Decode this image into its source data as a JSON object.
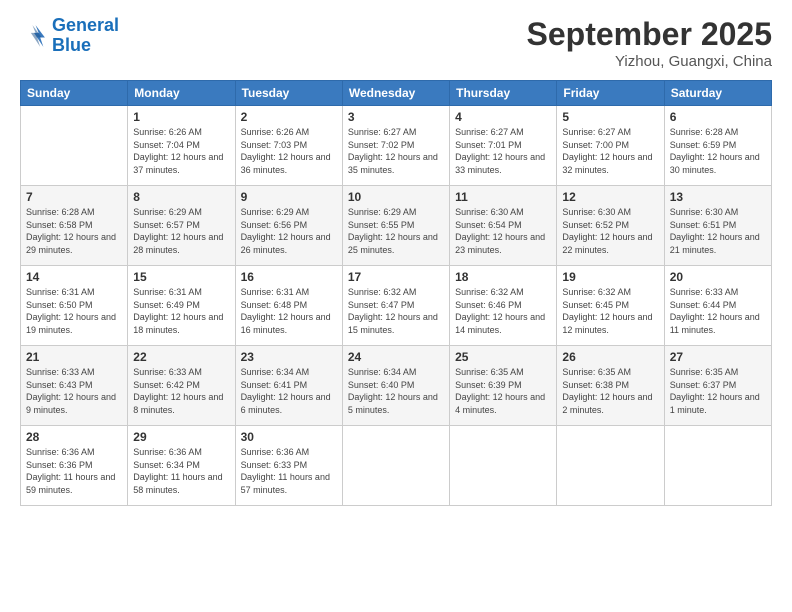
{
  "logo": {
    "line1": "General",
    "line2": "Blue"
  },
  "title": "September 2025",
  "subtitle": "Yizhou, Guangxi, China",
  "weekdays": [
    "Sunday",
    "Monday",
    "Tuesday",
    "Wednesday",
    "Thursday",
    "Friday",
    "Saturday"
  ],
  "weeks": [
    [
      {
        "day": "",
        "sunrise": "",
        "sunset": "",
        "daylight": ""
      },
      {
        "day": "1",
        "sunrise": "Sunrise: 6:26 AM",
        "sunset": "Sunset: 7:04 PM",
        "daylight": "Daylight: 12 hours and 37 minutes."
      },
      {
        "day": "2",
        "sunrise": "Sunrise: 6:26 AM",
        "sunset": "Sunset: 7:03 PM",
        "daylight": "Daylight: 12 hours and 36 minutes."
      },
      {
        "day": "3",
        "sunrise": "Sunrise: 6:27 AM",
        "sunset": "Sunset: 7:02 PM",
        "daylight": "Daylight: 12 hours and 35 minutes."
      },
      {
        "day": "4",
        "sunrise": "Sunrise: 6:27 AM",
        "sunset": "Sunset: 7:01 PM",
        "daylight": "Daylight: 12 hours and 33 minutes."
      },
      {
        "day": "5",
        "sunrise": "Sunrise: 6:27 AM",
        "sunset": "Sunset: 7:00 PM",
        "daylight": "Daylight: 12 hours and 32 minutes."
      },
      {
        "day": "6",
        "sunrise": "Sunrise: 6:28 AM",
        "sunset": "Sunset: 6:59 PM",
        "daylight": "Daylight: 12 hours and 30 minutes."
      }
    ],
    [
      {
        "day": "7",
        "sunrise": "Sunrise: 6:28 AM",
        "sunset": "Sunset: 6:58 PM",
        "daylight": "Daylight: 12 hours and 29 minutes."
      },
      {
        "day": "8",
        "sunrise": "Sunrise: 6:29 AM",
        "sunset": "Sunset: 6:57 PM",
        "daylight": "Daylight: 12 hours and 28 minutes."
      },
      {
        "day": "9",
        "sunrise": "Sunrise: 6:29 AM",
        "sunset": "Sunset: 6:56 PM",
        "daylight": "Daylight: 12 hours and 26 minutes."
      },
      {
        "day": "10",
        "sunrise": "Sunrise: 6:29 AM",
        "sunset": "Sunset: 6:55 PM",
        "daylight": "Daylight: 12 hours and 25 minutes."
      },
      {
        "day": "11",
        "sunrise": "Sunrise: 6:30 AM",
        "sunset": "Sunset: 6:54 PM",
        "daylight": "Daylight: 12 hours and 23 minutes."
      },
      {
        "day": "12",
        "sunrise": "Sunrise: 6:30 AM",
        "sunset": "Sunset: 6:52 PM",
        "daylight": "Daylight: 12 hours and 22 minutes."
      },
      {
        "day": "13",
        "sunrise": "Sunrise: 6:30 AM",
        "sunset": "Sunset: 6:51 PM",
        "daylight": "Daylight: 12 hours and 21 minutes."
      }
    ],
    [
      {
        "day": "14",
        "sunrise": "Sunrise: 6:31 AM",
        "sunset": "Sunset: 6:50 PM",
        "daylight": "Daylight: 12 hours and 19 minutes."
      },
      {
        "day": "15",
        "sunrise": "Sunrise: 6:31 AM",
        "sunset": "Sunset: 6:49 PM",
        "daylight": "Daylight: 12 hours and 18 minutes."
      },
      {
        "day": "16",
        "sunrise": "Sunrise: 6:31 AM",
        "sunset": "Sunset: 6:48 PM",
        "daylight": "Daylight: 12 hours and 16 minutes."
      },
      {
        "day": "17",
        "sunrise": "Sunrise: 6:32 AM",
        "sunset": "Sunset: 6:47 PM",
        "daylight": "Daylight: 12 hours and 15 minutes."
      },
      {
        "day": "18",
        "sunrise": "Sunrise: 6:32 AM",
        "sunset": "Sunset: 6:46 PM",
        "daylight": "Daylight: 12 hours and 14 minutes."
      },
      {
        "day": "19",
        "sunrise": "Sunrise: 6:32 AM",
        "sunset": "Sunset: 6:45 PM",
        "daylight": "Daylight: 12 hours and 12 minutes."
      },
      {
        "day": "20",
        "sunrise": "Sunrise: 6:33 AM",
        "sunset": "Sunset: 6:44 PM",
        "daylight": "Daylight: 12 hours and 11 minutes."
      }
    ],
    [
      {
        "day": "21",
        "sunrise": "Sunrise: 6:33 AM",
        "sunset": "Sunset: 6:43 PM",
        "daylight": "Daylight: 12 hours and 9 minutes."
      },
      {
        "day": "22",
        "sunrise": "Sunrise: 6:33 AM",
        "sunset": "Sunset: 6:42 PM",
        "daylight": "Daylight: 12 hours and 8 minutes."
      },
      {
        "day": "23",
        "sunrise": "Sunrise: 6:34 AM",
        "sunset": "Sunset: 6:41 PM",
        "daylight": "Daylight: 12 hours and 6 minutes."
      },
      {
        "day": "24",
        "sunrise": "Sunrise: 6:34 AM",
        "sunset": "Sunset: 6:40 PM",
        "daylight": "Daylight: 12 hours and 5 minutes."
      },
      {
        "day": "25",
        "sunrise": "Sunrise: 6:35 AM",
        "sunset": "Sunset: 6:39 PM",
        "daylight": "Daylight: 12 hours and 4 minutes."
      },
      {
        "day": "26",
        "sunrise": "Sunrise: 6:35 AM",
        "sunset": "Sunset: 6:38 PM",
        "daylight": "Daylight: 12 hours and 2 minutes."
      },
      {
        "day": "27",
        "sunrise": "Sunrise: 6:35 AM",
        "sunset": "Sunset: 6:37 PM",
        "daylight": "Daylight: 12 hours and 1 minute."
      }
    ],
    [
      {
        "day": "28",
        "sunrise": "Sunrise: 6:36 AM",
        "sunset": "Sunset: 6:36 PM",
        "daylight": "Daylight: 11 hours and 59 minutes."
      },
      {
        "day": "29",
        "sunrise": "Sunrise: 6:36 AM",
        "sunset": "Sunset: 6:34 PM",
        "daylight": "Daylight: 11 hours and 58 minutes."
      },
      {
        "day": "30",
        "sunrise": "Sunrise: 6:36 AM",
        "sunset": "Sunset: 6:33 PM",
        "daylight": "Daylight: 11 hours and 57 minutes."
      },
      {
        "day": "",
        "sunrise": "",
        "sunset": "",
        "daylight": ""
      },
      {
        "day": "",
        "sunrise": "",
        "sunset": "",
        "daylight": ""
      },
      {
        "day": "",
        "sunrise": "",
        "sunset": "",
        "daylight": ""
      },
      {
        "day": "",
        "sunrise": "",
        "sunset": "",
        "daylight": ""
      }
    ]
  ]
}
